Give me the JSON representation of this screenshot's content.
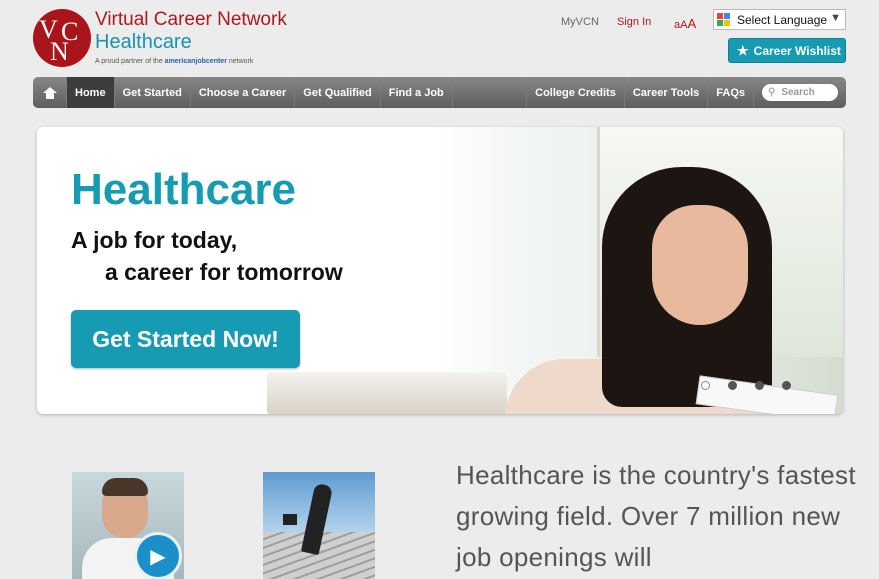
{
  "logo": {
    "monogram_1": "V",
    "monogram_2": "C",
    "monogram_3": "N",
    "title": "Virtual Career Network",
    "subtitle": "Healthcare",
    "tagline_prefix": "A proud partner of the",
    "tagline_brand": "americanjobcenter",
    "tagline_suffix": "network"
  },
  "top_links": {
    "myvcn": "MyVCN",
    "sign_in": "Sign In",
    "text_small": "aA",
    "text_large": "A"
  },
  "language": {
    "label": "Select Language",
    "arrow": "▼"
  },
  "wishlist": {
    "label": "Career Wishlist",
    "icon": "star-icon"
  },
  "nav": {
    "items": [
      {
        "label": "Home",
        "active": true
      },
      {
        "label": "Get Started"
      },
      {
        "label": "Choose a Career"
      },
      {
        "label": "Get Qualified"
      },
      {
        "label": "Find a Job"
      },
      {
        "label": "College Credits"
      },
      {
        "label": "Career Tools"
      },
      {
        "label": "FAQs"
      }
    ],
    "search_placeholder": "Search"
  },
  "hero": {
    "title": "Healthcare",
    "line1": "A job for today,",
    "line2": "a career for tomorrow",
    "cta": "Get Started Now!",
    "slides": 4,
    "active_slide": 1
  },
  "blurb": "Healthcare is the country's fastest growing field. Over 7 million new job openings will",
  "colors": {
    "brand_red": "#b0171f",
    "brand_teal": "#179bb3",
    "nav": "#6e6e6e"
  }
}
